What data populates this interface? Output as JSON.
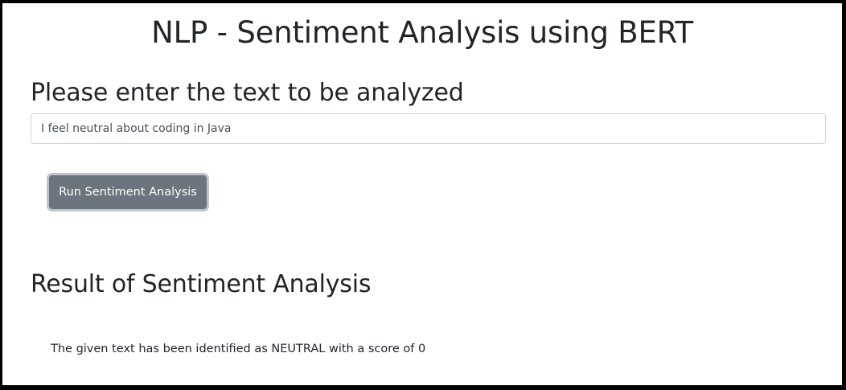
{
  "page": {
    "title": "NLP - Sentiment Analysis using BERT"
  },
  "input_section": {
    "heading": "Please enter the text to be analyzed",
    "text_value": "I feel neutral about coding in Java"
  },
  "actions": {
    "run_label": "Run Sentiment Analysis"
  },
  "result_section": {
    "heading": "Result of Sentiment Analysis",
    "result_text": "The given text has been identified as NEUTRAL with a score of 0"
  },
  "colors": {
    "button_bg": "#6c757d",
    "text": "#212529",
    "input_border": "#ced4da"
  }
}
